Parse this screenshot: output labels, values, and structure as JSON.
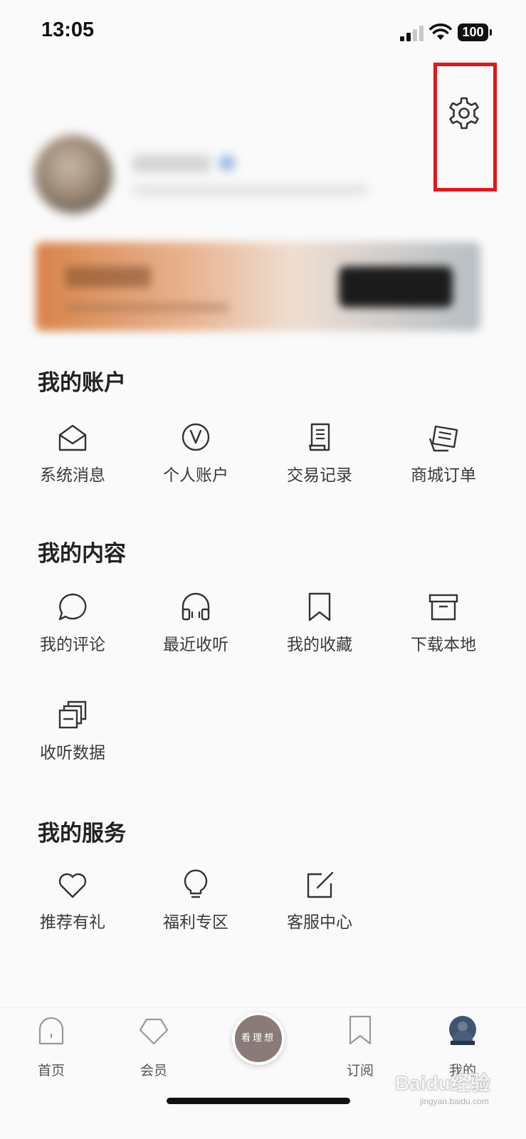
{
  "status_bar": {
    "time": "13:05",
    "battery": "100"
  },
  "center_button": {
    "label": "看理想"
  },
  "sections": {
    "account": {
      "title": "我的账户",
      "items": [
        {
          "label": "系统消息",
          "icon": "envelope-open-icon"
        },
        {
          "label": "个人账户",
          "icon": "v-circle-icon"
        },
        {
          "label": "交易记录",
          "icon": "receipt-icon"
        },
        {
          "label": "商城订单",
          "icon": "order-list-icon"
        }
      ]
    },
    "content": {
      "title": "我的内容",
      "items": [
        {
          "label": "我的评论",
          "icon": "chat-bubble-icon"
        },
        {
          "label": "最近收听",
          "icon": "headphones-icon"
        },
        {
          "label": "我的收藏",
          "icon": "bookmark-icon"
        },
        {
          "label": "下载本地",
          "icon": "archive-box-icon"
        },
        {
          "label": "收听数据",
          "icon": "stacked-cards-icon"
        }
      ]
    },
    "services": {
      "title": "我的服务",
      "items": [
        {
          "label": "推荐有礼",
          "icon": "heart-icon"
        },
        {
          "label": "福利专区",
          "icon": "lightbulb-icon"
        },
        {
          "label": "客服中心",
          "icon": "edit-square-icon"
        }
      ]
    }
  },
  "tab_bar": {
    "tabs": [
      {
        "label": "首页",
        "icon": "home-icon"
      },
      {
        "label": "会员",
        "icon": "pentagon-icon"
      },
      {
        "label": "订阅",
        "icon": "bookmark-icon"
      },
      {
        "label": "我的",
        "icon": "avatar-icon"
      }
    ]
  },
  "watermark": {
    "brand": "Baidu经验",
    "url": "jingyan.baidu.com"
  },
  "colors": {
    "highlight": "#e8141b",
    "text": "#333333",
    "background": "#fafafa"
  }
}
